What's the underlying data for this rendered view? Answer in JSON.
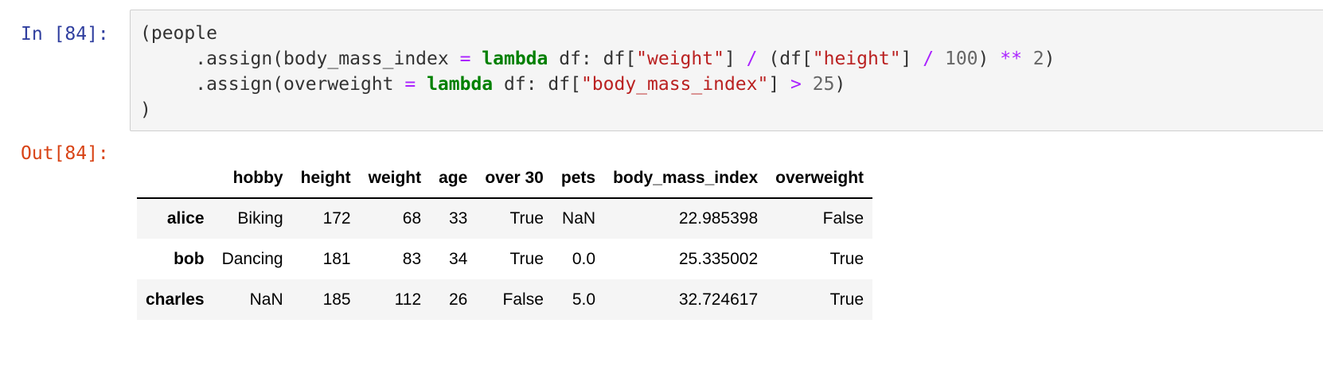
{
  "cell": {
    "in_prompt": "In [84]:",
    "out_prompt": "Out[84]:",
    "code_lines": [
      [
        {
          "t": "(people",
          "c": ""
        }
      ],
      [
        {
          "t": "     .assign(body_mass_index ",
          "c": ""
        },
        {
          "t": "=",
          "c": "op"
        },
        {
          "t": " ",
          "c": ""
        },
        {
          "t": "lambda",
          "c": "kw"
        },
        {
          "t": " df: df[",
          "c": ""
        },
        {
          "t": "\"weight\"",
          "c": "str"
        },
        {
          "t": "] ",
          "c": ""
        },
        {
          "t": "/",
          "c": "op"
        },
        {
          "t": " (df[",
          "c": ""
        },
        {
          "t": "\"height\"",
          "c": "str"
        },
        {
          "t": "] ",
          "c": ""
        },
        {
          "t": "/",
          "c": "op"
        },
        {
          "t": " ",
          "c": ""
        },
        {
          "t": "100",
          "c": "num"
        },
        {
          "t": ") ",
          "c": ""
        },
        {
          "t": "**",
          "c": "op"
        },
        {
          "t": " ",
          "c": ""
        },
        {
          "t": "2",
          "c": "num"
        },
        {
          "t": ")",
          "c": ""
        }
      ],
      [
        {
          "t": "     .assign(overweight ",
          "c": ""
        },
        {
          "t": "=",
          "c": "op"
        },
        {
          "t": " ",
          "c": ""
        },
        {
          "t": "lambda",
          "c": "kw"
        },
        {
          "t": " df: df[",
          "c": ""
        },
        {
          "t": "\"body_mass_index\"",
          "c": "str"
        },
        {
          "t": "] ",
          "c": ""
        },
        {
          "t": ">",
          "c": "op"
        },
        {
          "t": " ",
          "c": ""
        },
        {
          "t": "25",
          "c": "num"
        },
        {
          "t": ")",
          "c": ""
        }
      ],
      [
        {
          "t": ")",
          "c": ""
        }
      ]
    ]
  },
  "output": {
    "columns": [
      "",
      "hobby",
      "height",
      "weight",
      "age",
      "over 30",
      "pets",
      "body_mass_index",
      "overweight"
    ],
    "rows": [
      {
        "index": "alice",
        "cells": [
          "Biking",
          "172",
          "68",
          "33",
          "True",
          "NaN",
          "22.985398",
          "False"
        ]
      },
      {
        "index": "bob",
        "cells": [
          "Dancing",
          "181",
          "83",
          "34",
          "True",
          "0.0",
          "25.335002",
          "True"
        ]
      },
      {
        "index": "charles",
        "cells": [
          "NaN",
          "185",
          "112",
          "26",
          "False",
          "5.0",
          "32.724617",
          "True"
        ]
      }
    ]
  },
  "colors": {
    "in_prompt": "#303f9f",
    "out_prompt": "#d84315",
    "keyword": "#008000",
    "string": "#ba2121",
    "operator": "#aa22ff",
    "number": "#666666",
    "code_bg": "#f5f5f5",
    "stripe_bg": "#f5f5f5"
  }
}
